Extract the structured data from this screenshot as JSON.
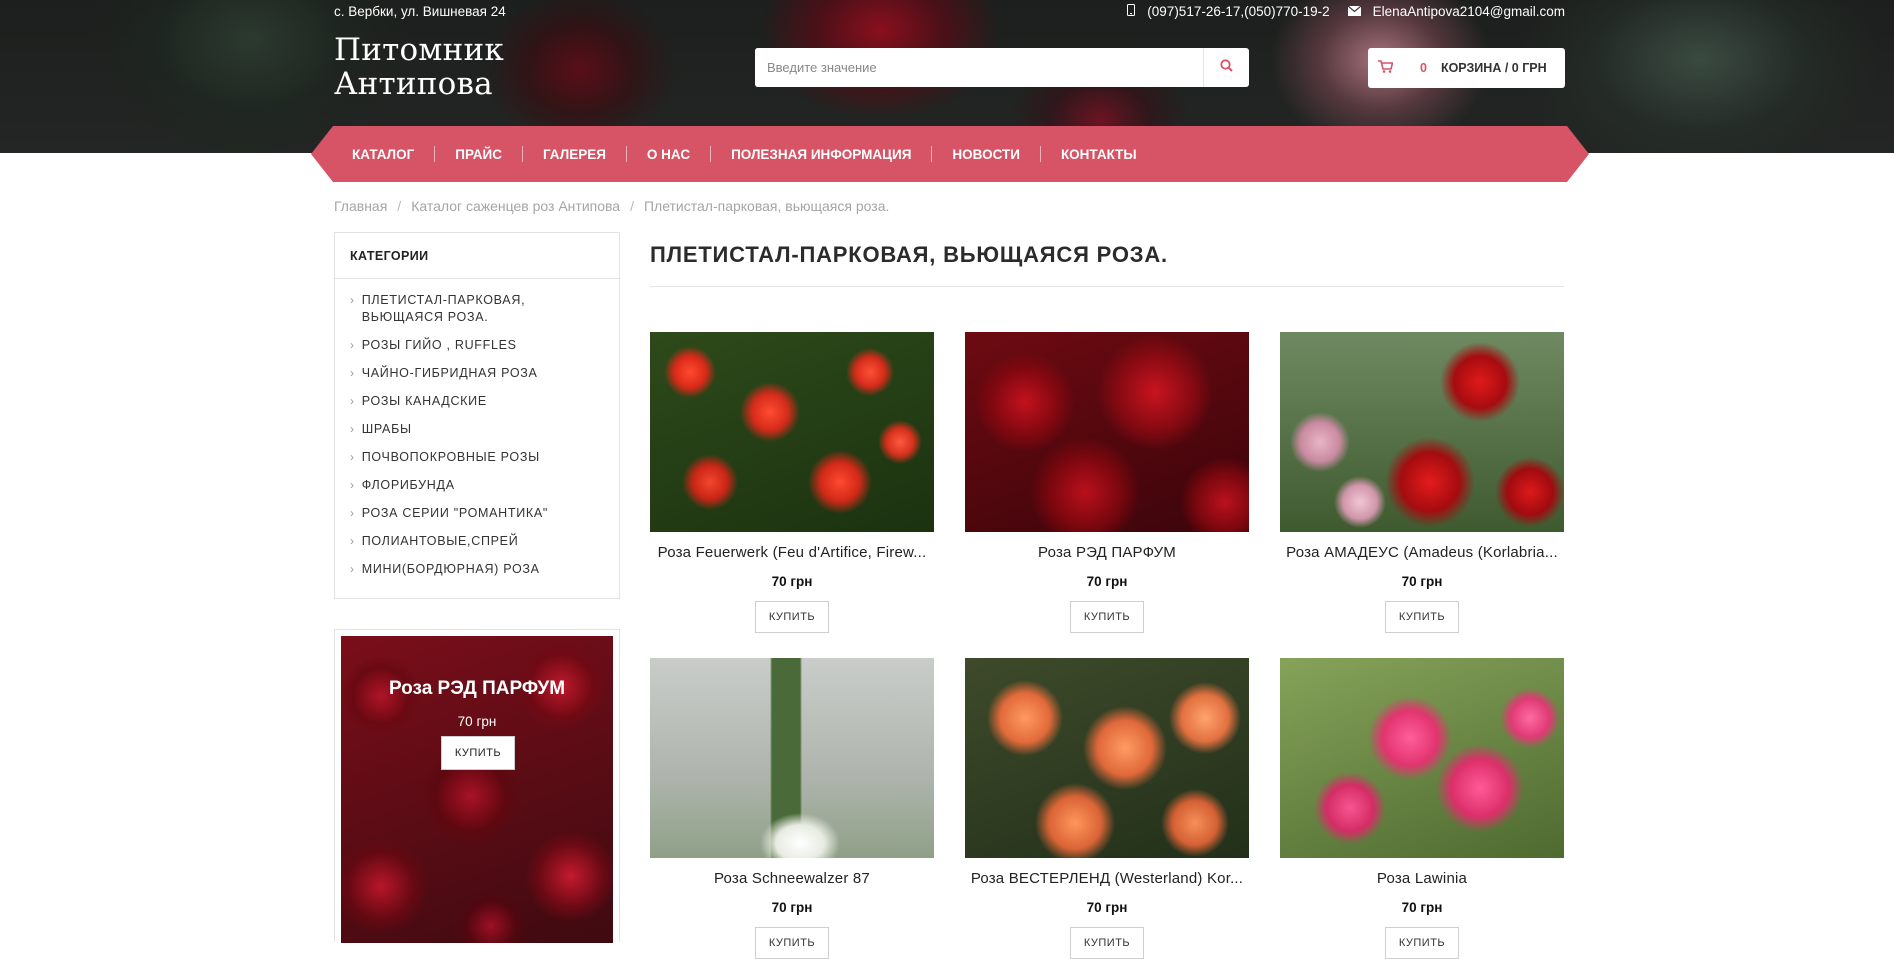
{
  "topbar": {
    "address": "с. Вербки, ул. Вишневая 24",
    "phone": "(097)517-26-17,(050)770-19-2",
    "email": "ElenaAntipova2104@gmail.com"
  },
  "logo": {
    "line1": "Питомник",
    "line2": "Антипова"
  },
  "search": {
    "placeholder": "Введите значение",
    "icon": "search-icon"
  },
  "cart": {
    "count": "0",
    "label": "КОРЗИНА / 0 ГРН",
    "icon": "shopping-cart-icon"
  },
  "nav": [
    "КАТАЛОГ",
    "ПРАЙС",
    "ГАЛЕРЕЯ",
    "О НАС",
    "ПОЛЕЗНАЯ ИНФОРМАЦИЯ",
    "НОВОСТИ",
    "КОНТАКТЫ"
  ],
  "breadcrumb": [
    "Главная",
    "Каталог саженцев роз Антипова",
    "Плетистал-парковая, вьющаяся роза."
  ],
  "sidebar": {
    "heading": "КАТЕГОРИИ",
    "categories": [
      "ПЛЕТИСТАЛ-ПАРКОВАЯ, ВЬЮЩАЯСЯ РОЗА.",
      "РОЗЫ ГИЙО , RUFFLES",
      "ЧАЙНО-ГИБРИДНАЯ РОЗА",
      "РОЗЫ КАНАДСКИЕ",
      "ШРАБЫ",
      "ПОЧВОПОКРОВНЫЕ РОЗЫ",
      "ФЛОРИБУНДА",
      "РОЗА СЕРИИ \"РОМАНТИКА\"",
      "ПОЛИАНТОВЫЕ,СПРЕЙ",
      "МИНИ(БОРДЮРНАЯ) РОЗА"
    ]
  },
  "promo": {
    "title": "Роза РЭД ПАРФУМ",
    "price": "70 грн",
    "buy": "КУПИТЬ"
  },
  "page_title": "ПЛЕТИСТАЛ-ПАРКОВАЯ, ВЬЮЩАЯСЯ РОЗА.",
  "products": [
    {
      "name": "Роза Feuerwerk (Feu d'Artifice, Firew...",
      "price": "70 грн",
      "buy": "КУПИТЬ"
    },
    {
      "name": "Роза РЭД ПАРФУМ",
      "price": "70 грн",
      "buy": "КУПИТЬ"
    },
    {
      "name": "Роза АМАДЕУС (Amadeus (Korlabria...",
      "price": "70 грн",
      "buy": "КУПИТЬ"
    },
    {
      "name": "Роза Schneewalzer 87",
      "price": "70 грн",
      "buy": "КУПИТЬ"
    },
    {
      "name": "Роза ВЕСТЕРЛЕНД (Westerland) Kor...",
      "price": "70 грн",
      "buy": "КУПИТЬ"
    },
    {
      "name": "Роза Lawinia",
      "price": "70 грн",
      "buy": "КУПИТЬ"
    }
  ],
  "colors": {
    "accent": "#d65466",
    "header_bg": "#1f2220"
  }
}
